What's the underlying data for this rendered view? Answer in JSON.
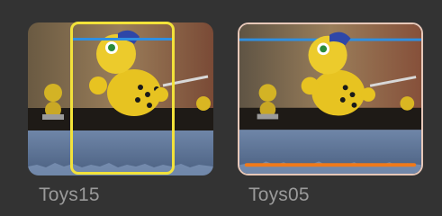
{
  "browser": {
    "clips": [
      {
        "name": "Toys15",
        "selected": true,
        "favorite_bar": false,
        "marker_color": "#2f8fe0"
      },
      {
        "name": "Toys05",
        "selected": false,
        "favorite_bar": true,
        "marker_color": "#2f8fe0",
        "favorite_color": "#f07a1a"
      }
    ],
    "selection_color": "#f2e23a"
  }
}
